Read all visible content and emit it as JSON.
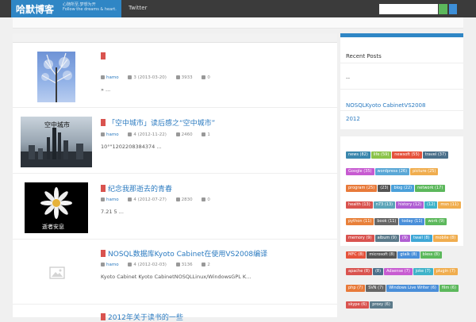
{
  "header": {
    "site_title": "哈默博客",
    "tagline_1": "心随所至,梦想为开",
    "tagline_2": "Follow the dreams & heart.",
    "nav_item": "Twitter"
  },
  "posts": [
    {
      "title": "",
      "author": "hamo",
      "date": "3 (2013-03-20)",
      "views": "3933",
      "comments": "0",
      "excerpt": "» ..."
    },
    {
      "title": "「空中城市」读后感之“空中城市”",
      "thumb_text": "空中城市",
      "author": "hamo",
      "date": "4 (2012-11-22)",
      "views": "2460",
      "comments": "1",
      "excerpt": "10°\"1202208384374 ..."
    },
    {
      "title": "纪念我那逝去的青春",
      "thumb_text": "逝者安息",
      "author": "hamo",
      "date": "4 (2012-07-27)",
      "views": "2830",
      "comments": "0",
      "excerpt": "7.21 5 ..."
    },
    {
      "title": "NOSQL数据库Kyoto Cabinet在使用VS2008编译",
      "author": "hamo",
      "date": "4 (2012-02-03)",
      "views": "3136",
      "comments": "2",
      "excerpt": "Kyoto Cabinet Kyoto CabinetNOSQLLinux/WindowsGPL K..."
    },
    {
      "title": "2012年关于读书的一些"
    }
  ],
  "sidebar": {
    "recent_title": "Recent Posts",
    "recent_items": [
      "--",
      "NOSQLKyoto CabinetVS2008",
      "2012"
    ]
  },
  "tags": [
    {
      "label": "news (82)",
      "color": "#3a87ad"
    },
    {
      "label": "life (59)",
      "color": "#8bc34a"
    },
    {
      "label": "newsoft (55)",
      "color": "#e5533c"
    },
    {
      "label": "travel (37)",
      "color": "#4a6f8a"
    },
    {
      "label": "Google (35)",
      "color": "#c75bd1"
    },
    {
      "label": "wordpress (26)",
      "color": "#5aa7d6"
    },
    {
      "label": "picture (25)",
      "color": "#f0ad4e"
    },
    {
      "label": "program (25)",
      "color": "#e87a3a"
    },
    {
      "label": "(23)",
      "color": "#555555"
    },
    {
      "label": "blog (22)",
      "color": "#4aa0d9"
    },
    {
      "label": "network (17)",
      "color": "#5cb85c"
    },
    {
      "label": "health (13)",
      "color": "#d9534f"
    },
    {
      "label": "n73 (13)",
      "color": "#5ba4b8"
    },
    {
      "label": "history (12)",
      "color": "#b05fd3"
    },
    {
      "label": "(12)",
      "color": "#3fb3c9"
    },
    {
      "label": "msn (11)",
      "color": "#f0ad4e"
    },
    {
      "label": "python (11)",
      "color": "#e8803a"
    },
    {
      "label": "book (11)",
      "color": "#666666"
    },
    {
      "label": "today (11)",
      "color": "#4a8fd9"
    },
    {
      "label": "work (9)",
      "color": "#5cb85c"
    },
    {
      "label": "memory (9)",
      "color": "#d9534f"
    },
    {
      "label": "album (9)",
      "color": "#5b7a8a"
    },
    {
      "label": "(9)",
      "color": "#b05fd3"
    },
    {
      "label": "twail (8)",
      "color": "#3fa7d6"
    },
    {
      "label": "mobile (8)",
      "color": "#f0ad4e"
    },
    {
      "label": "MFC (8)",
      "color": "#e5533c"
    },
    {
      "label": "microsoft (8)",
      "color": "#555555"
    },
    {
      "label": "gtalk (8)",
      "color": "#4a8fd9"
    },
    {
      "label": "bless (8)",
      "color": "#5cb85c"
    },
    {
      "label": "apache (8)",
      "color": "#d9534f"
    },
    {
      "label": "(8)",
      "color": "#4a6f8a"
    },
    {
      "label": "Adsense (7)",
      "color": "#c75bd1"
    },
    {
      "label": "joke (7)",
      "color": "#3fb3c9"
    },
    {
      "label": "plugin (7)",
      "color": "#f0ad4e"
    },
    {
      "label": "php (7)",
      "color": "#e87a3a"
    },
    {
      "label": "SVN (7)",
      "color": "#666666"
    },
    {
      "label": "Windows Live Writer (6)",
      "color": "#4a8fd9"
    },
    {
      "label": "film (6)",
      "color": "#5cb85c"
    },
    {
      "label": "skype (6)",
      "color": "#d9534f"
    },
    {
      "label": "proxy (6)",
      "color": "#5b7a8a"
    }
  ]
}
